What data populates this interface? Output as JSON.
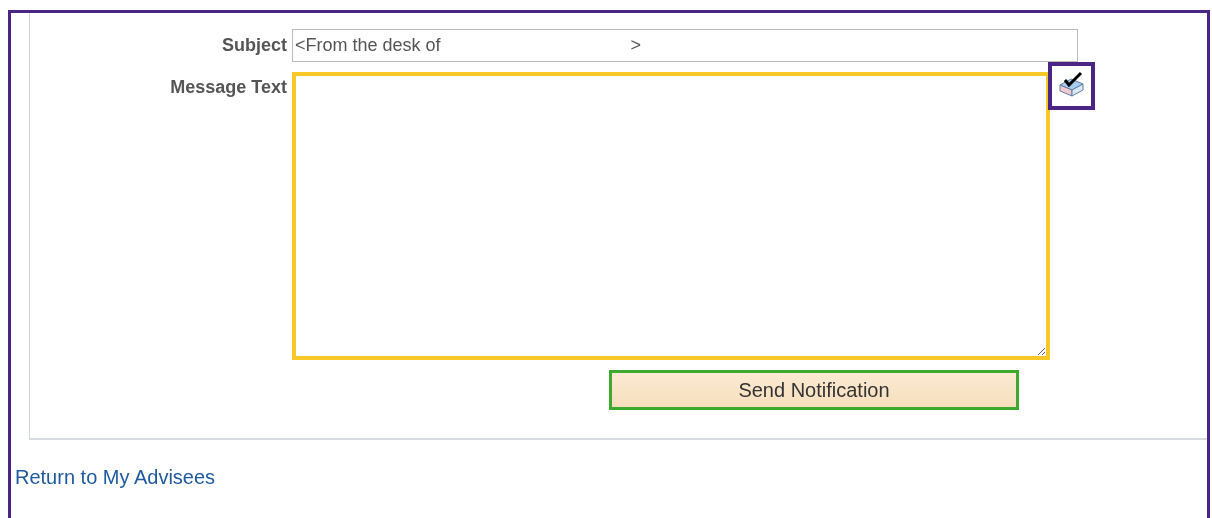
{
  "form": {
    "subject": {
      "label": "Subject",
      "value": "<From the desk of                                      >"
    },
    "message": {
      "label": "Message Text"
    },
    "send_button": "Send Notification"
  },
  "links": [
    "Return to My Advisees"
  ]
}
